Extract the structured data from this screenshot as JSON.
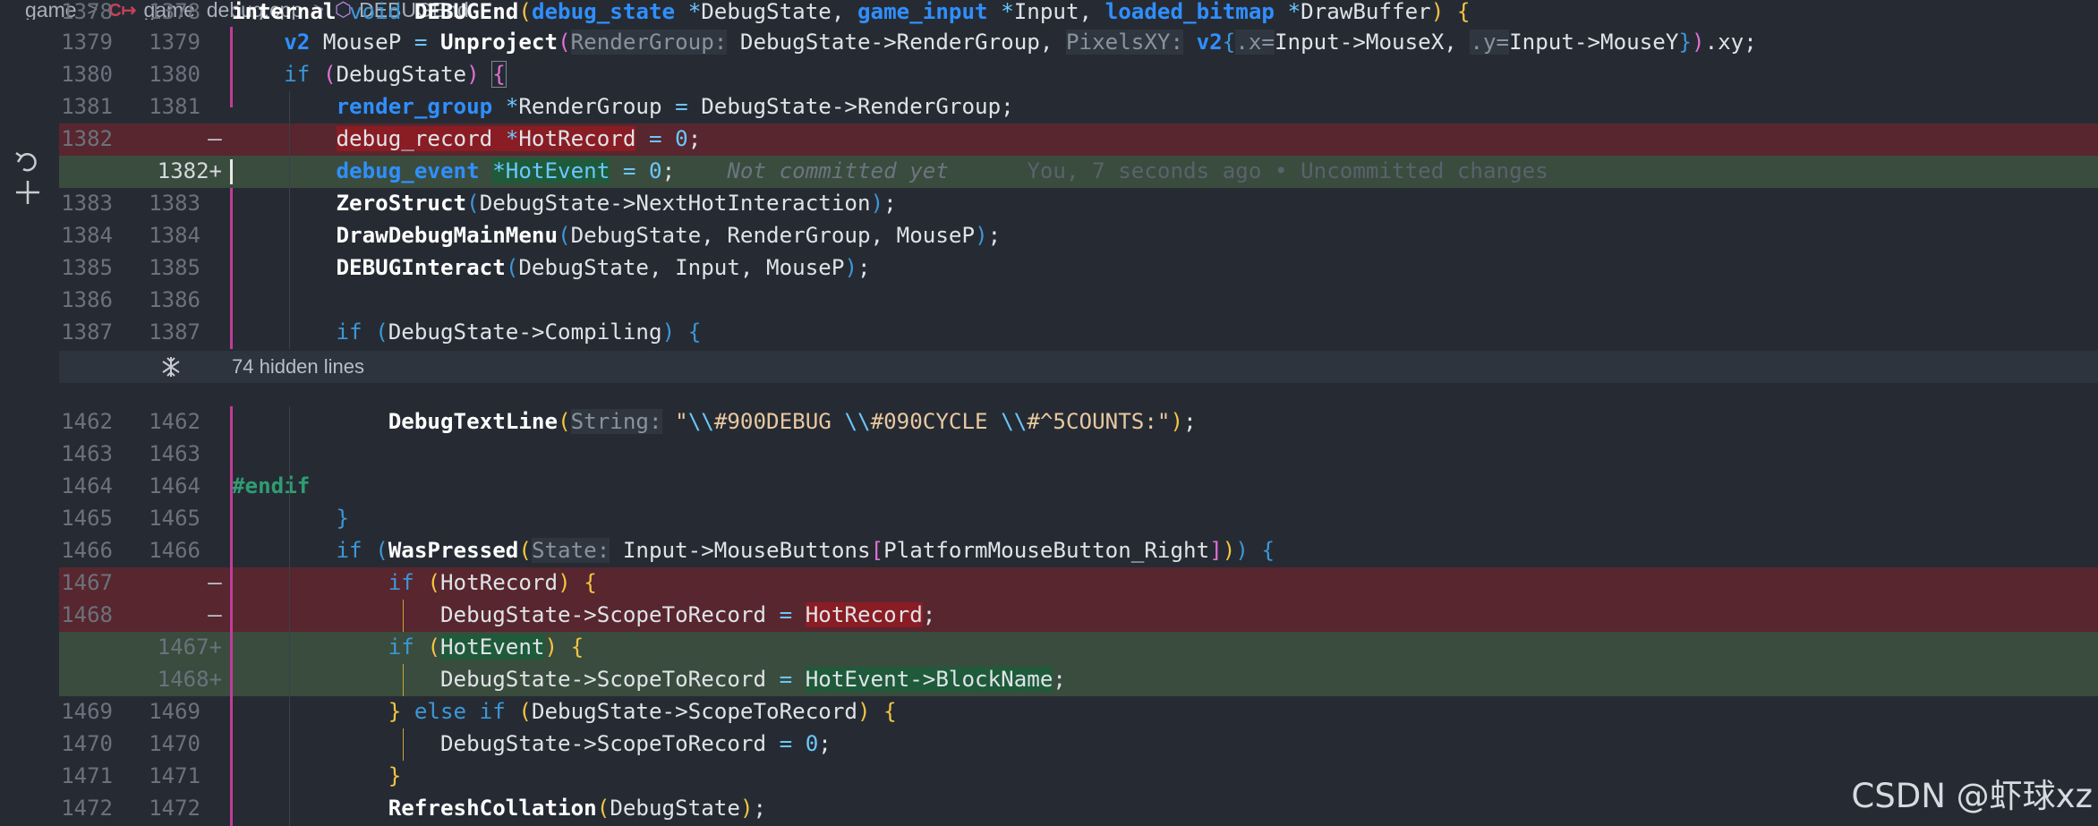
{
  "breadcrumb": {
    "items": [
      "game",
      "game_debug.cpp",
      "DEBUGEnd"
    ],
    "file_icon": "c++-file-icon",
    "symbol_icon": "cube-icon"
  },
  "gutter_icons": {
    "revert": "undo-arrow-icon",
    "stage": "plus-icon"
  },
  "editor": {
    "lines": [
      {
        "old": "1378",
        "new": "1378",
        "kind": "ctx",
        "text": "internal void DEBUGEnd(debug_state *DebugState, game_input *Input, loaded_bitmap *DrawBuffer) {"
      },
      {
        "old": "1379",
        "new": "1379",
        "kind": "ctx",
        "text": "    v2 MouseP = Unproject(RenderGroup: DebugState->RenderGroup, PixelsXY: v2{.x=Input->MouseX, .y=Input->MouseY}).xy;"
      },
      {
        "old": "1380",
        "new": "1380",
        "kind": "ctx",
        "text": "    if (DebugState) {"
      },
      {
        "old": "1381",
        "new": "1381",
        "kind": "ctx",
        "text": "        render_group *RenderGroup = DebugState->RenderGroup;"
      },
      {
        "old": "1382",
        "new": "—",
        "kind": "del",
        "text": "        debug_record *HotRecord = 0;"
      },
      {
        "old": "",
        "new": "1382+",
        "kind": "ins",
        "text": "        debug_event *HotEvent = 0;"
      },
      {
        "old": "1383",
        "new": "1383",
        "kind": "ctx",
        "text": "        ZeroStruct(DebugState->NextHotInteraction);"
      },
      {
        "old": "1384",
        "new": "1384",
        "kind": "ctx",
        "text": "        DrawDebugMainMenu(DebugState, RenderGroup, MouseP);"
      },
      {
        "old": "1385",
        "new": "1385",
        "kind": "ctx",
        "text": "        DEBUGInteract(DebugState, Input, MouseP);"
      },
      {
        "old": "1386",
        "new": "1386",
        "kind": "ctx",
        "text": ""
      },
      {
        "old": "1387",
        "new": "1387",
        "kind": "ctx",
        "text": "        if (DebugState->Compiling) {"
      },
      {
        "old": "",
        "new": "",
        "kind": "hidden",
        "text": "74 hidden lines"
      },
      {
        "old": "1462",
        "new": "1462",
        "kind": "ctx",
        "text": "            DebugTextLine(String: \"\\\\#900DEBUG \\\\#090CYCLE \\\\#^5COUNTS:\");"
      },
      {
        "old": "1463",
        "new": "1463",
        "kind": "ctx",
        "text": ""
      },
      {
        "old": "1464",
        "new": "1464",
        "kind": "ctx",
        "text": "#endif"
      },
      {
        "old": "1465",
        "new": "1465",
        "kind": "ctx",
        "text": "        }"
      },
      {
        "old": "1466",
        "new": "1466",
        "kind": "ctx",
        "text": "        if (WasPressed(State: Input->MouseButtons[PlatformMouseButton_Right])) {"
      },
      {
        "old": "1467",
        "new": "—",
        "kind": "del",
        "text": "            if (HotRecord) {"
      },
      {
        "old": "1468",
        "new": "—",
        "kind": "del",
        "text": "                DebugState->ScopeToRecord = HotRecord;"
      },
      {
        "old": "",
        "new": "1467+",
        "kind": "ins",
        "text": "            if (HotEvent) {"
      },
      {
        "old": "",
        "new": "1468+",
        "kind": "ins",
        "text": "                DebugState->ScopeToRecord = HotEvent->BlockName;"
      },
      {
        "old": "1469",
        "new": "1469",
        "kind": "ctx",
        "text": "            } else if (DebugState->ScopeToRecord) {"
      },
      {
        "old": "1470",
        "new": "1470",
        "kind": "ctx",
        "text": "                DebugState->ScopeToRecord = 0;"
      },
      {
        "old": "1471",
        "new": "1471",
        "kind": "ctx",
        "text": "            }"
      },
      {
        "old": "1472",
        "new": "1472",
        "kind": "ctx",
        "text": "            RefreshCollation(DebugState);"
      }
    ],
    "blame": {
      "status": "Not committed yet",
      "author": "You, 7 seconds ago • Uncommitted changes"
    }
  },
  "watermark": "CSDN @虾球xz"
}
